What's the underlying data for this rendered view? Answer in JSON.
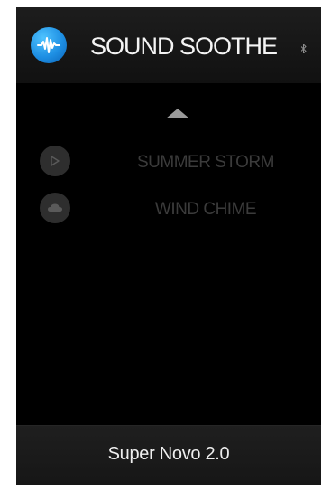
{
  "header": {
    "app_title": "SOUND SOOTHE",
    "logo_icon": "sound-wave-icon",
    "status_icon": "bluetooth-icon",
    "accent_color": "#1e8fe3"
  },
  "list": {
    "scroll_up_icon": "triangle-up-icon",
    "items": [
      {
        "label": "SUMMER STORM",
        "icon": "play-icon"
      },
      {
        "label": "WIND CHIME",
        "icon": "cloud-icon"
      }
    ]
  },
  "footer": {
    "label": "Super Novo 2.0"
  }
}
